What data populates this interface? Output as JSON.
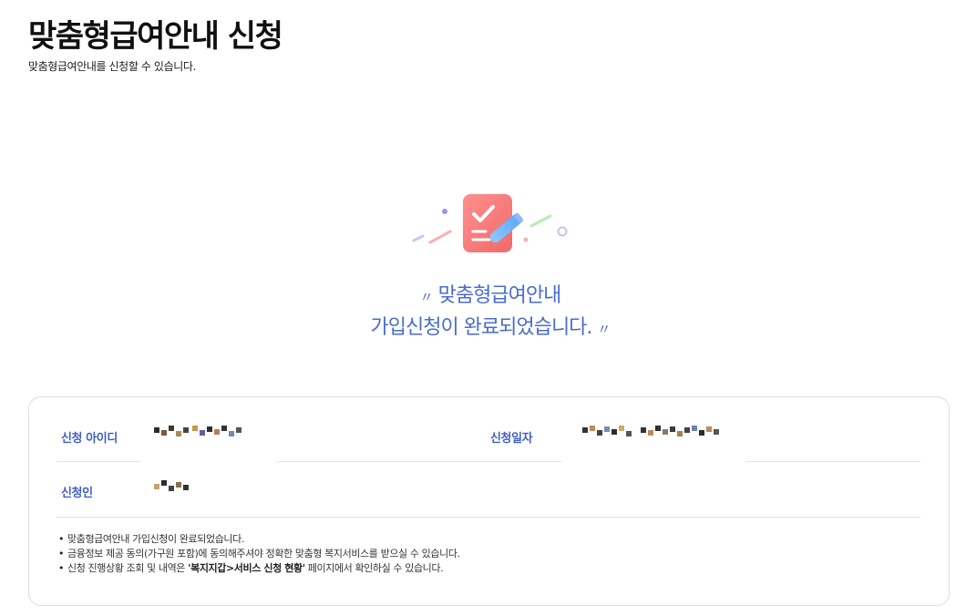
{
  "header": {
    "title": "맞춤형급여안내 신청",
    "subtitle": "맞춤형급여안내를 신청할 수 있습니다."
  },
  "completion": {
    "icon": "checklist-clipboard-icon",
    "open_quote": "〃",
    "close_quote": "〃",
    "line1": "맞춤형급여안내",
    "line2": "가입신청이 완료되었습니다."
  },
  "info": {
    "applicant_id_label": "신청 아이디",
    "applicant_id_value": "",
    "application_date_label": "신청일자",
    "application_date_value": "",
    "applicant_label": "신청인",
    "applicant_value": "",
    "notes": [
      {
        "text": "맞춤형급여안내 가입신청이 완료되었습니다."
      },
      {
        "text": "금융정보 제공 동의(가구원 포함)에 동의해주셔야 정확한 맞춤형 복지서비스를 받으실 수 있습니다."
      },
      {
        "pre": "신청 진행상황 조회 및 내역은 ",
        "bold": "'복지지갑>서비스 신청 현황'",
        "post": " 페이지에서 확인하실 수 있습니다."
      }
    ]
  },
  "colors": {
    "accent_blue": "#4b6ccf",
    "label_blue": "#4060c8",
    "icon_red": "#f07a7a"
  }
}
